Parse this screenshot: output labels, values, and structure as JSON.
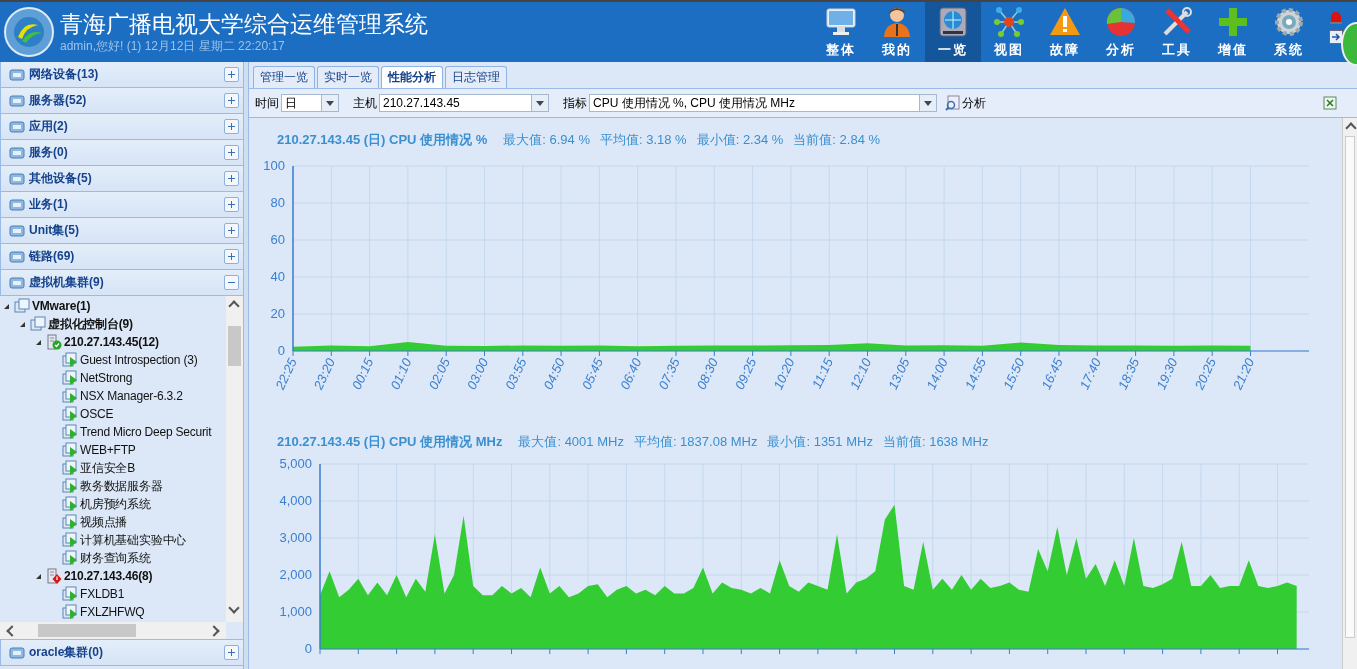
{
  "header": {
    "title": "青海广播电视大学综合运维管理系统",
    "subtitle": "admin,您好! (1) 12月12日 星期二 22:20:17"
  },
  "nav": [
    {
      "label": "整体",
      "selected": false
    },
    {
      "label": "我的",
      "selected": false
    },
    {
      "label": "一览",
      "selected": true
    },
    {
      "label": "视图",
      "selected": false
    },
    {
      "label": "故障",
      "selected": false
    },
    {
      "label": "分析",
      "selected": false
    },
    {
      "label": "工具",
      "selected": false
    },
    {
      "label": "增值",
      "selected": false
    },
    {
      "label": "系统",
      "selected": false
    }
  ],
  "sidebar": {
    "groups": [
      {
        "label": "网络设备(13)",
        "expanded": false
      },
      {
        "label": "服务器(52)",
        "expanded": false
      },
      {
        "label": "应用(2)",
        "expanded": false
      },
      {
        "label": "服务(0)",
        "expanded": false
      },
      {
        "label": "其他设备(5)",
        "expanded": false
      },
      {
        "label": "业务(1)",
        "expanded": false
      },
      {
        "label": "Unit集(5)",
        "expanded": false
      },
      {
        "label": "链路(69)",
        "expanded": false
      },
      {
        "label": "虚拟机集群(9)",
        "expanded": true,
        "children": [
          {
            "label": "VMware(1)",
            "kind": "cluster",
            "expanded": true,
            "children": [
              {
                "label": "虚拟化控制台(9)",
                "kind": "cluster",
                "expanded": true,
                "children": [
                  {
                    "label": "210.27.143.45(12)",
                    "kind": "host",
                    "alarm": false,
                    "expanded": true,
                    "children": [
                      {
                        "label": "Guest Introspection (3)",
                        "kind": "vm"
                      },
                      {
                        "label": "NetStrong",
                        "kind": "vm"
                      },
                      {
                        "label": "NSX Manager-6.3.2",
                        "kind": "vm"
                      },
                      {
                        "label": "OSCE",
                        "kind": "vm"
                      },
                      {
                        "label": "Trend Micro Deep Securit",
                        "kind": "vm"
                      },
                      {
                        "label": "WEB+FTP",
                        "kind": "vm"
                      },
                      {
                        "label": "亚信安全B",
                        "kind": "vm"
                      },
                      {
                        "label": "教务数据服务器",
                        "kind": "vm"
                      },
                      {
                        "label": "机房预约系统",
                        "kind": "vm"
                      },
                      {
                        "label": "视频点播",
                        "kind": "vm"
                      },
                      {
                        "label": "计算机基础实验中心",
                        "kind": "vm"
                      },
                      {
                        "label": "财务查询系统",
                        "kind": "vm"
                      }
                    ]
                  },
                  {
                    "label": "210.27.143.46(8)",
                    "kind": "host",
                    "alarm": true,
                    "expanded": true,
                    "children": [
                      {
                        "label": "FXLDB1",
                        "kind": "vm"
                      },
                      {
                        "label": "FXLZHFWQ",
                        "kind": "vm"
                      }
                    ]
                  }
                ]
              }
            ]
          }
        ]
      },
      {
        "label": "oracle集群(0)",
        "expanded": false
      }
    ]
  },
  "tabs": [
    {
      "label": "管理一览",
      "selected": false
    },
    {
      "label": "实时一览",
      "selected": false
    },
    {
      "label": "性能分析",
      "selected": true
    },
    {
      "label": "日志管理",
      "selected": false
    }
  ],
  "toolbar": {
    "time_label": "时间",
    "time_value": "日",
    "host_label": "主机",
    "host_value": "210.27.143.45",
    "metric_label": "指标",
    "metric_value": "CPU 使用情况 %, CPU 使用情况 MHz",
    "analyze_button": "分析"
  },
  "charts": [
    {
      "stats": [
        "最大值: 6.94 %",
        "平均值: 3.18 %",
        "最小值: 2.34 %",
        "当前值: 2.84 %"
      ],
      "chart_data": {
        "type": "area",
        "title": "210.27.143.45 (日) CPU 使用情况 %",
        "ylim": [
          0,
          100
        ],
        "yticks": [
          0,
          20,
          40,
          60,
          80,
          100
        ],
        "grid": true,
        "categories": [
          "22:25",
          "23:20",
          "00:15",
          "01:10",
          "02:05",
          "03:00",
          "03:55",
          "04:50",
          "05:45",
          "06:40",
          "07:35",
          "08:30",
          "09:25",
          "10:20",
          "11:15",
          "12:10",
          "13:05",
          "14:00",
          "14:55",
          "15:50",
          "16:45",
          "17:40",
          "18:35",
          "19:30",
          "20:25",
          "21:20"
        ],
        "series": [
          {
            "color": "#33cc33",
            "values": [
              2.3,
              2.9,
              2.6,
              4.9,
              2.8,
              2.7,
              3.0,
              2.8,
              2.9,
              2.6,
              2.8,
              3.0,
              2.9,
              3.1,
              3.3,
              4.2,
              2.9,
              3.1,
              2.8,
              4.6,
              3.3,
              2.9,
              3.0,
              2.8,
              3.0,
              2.8
            ]
          }
        ]
      }
    },
    {
      "stats": [
        "最大值: 4001 MHz",
        "平均值: 1837.08 MHz",
        "最小值: 1351 MHz",
        "当前值: 1638 MHz"
      ],
      "chart_data": {
        "type": "area",
        "title": "210.27.143.45 (日) CPU 使用情况 MHz",
        "ylim": [
          0,
          5000
        ],
        "yticks": [
          {
            "value": 0,
            "label": "0"
          },
          {
            "value": 1000,
            "label": "1,000"
          },
          {
            "value": 2000,
            "label": "2,000"
          },
          {
            "value": 3000,
            "label": "3,000"
          },
          {
            "value": 4000,
            "label": "4,000"
          },
          {
            "value": 5000,
            "label": "5,000"
          }
        ],
        "grid": true,
        "series": [
          {
            "color": "#33cc33",
            "values": [
              1450,
              2100,
              1400,
              1600,
              1900,
              1450,
              1800,
              1450,
              2000,
              1400,
              1900,
              1550,
              3100,
              1500,
              2000,
              3600,
              1700,
              1450,
              1450,
              1700,
              1500,
              1650,
              1400,
              2200,
              1500,
              1700,
              1400,
              1500,
              1700,
              1750,
              1400,
              1600,
              1700,
              1500,
              1600,
              1450,
              1700,
              1500,
              1500,
              1650,
              2200,
              1500,
              1800,
              1650,
              1600,
              1500,
              1650,
              1500,
              2400,
              1700,
              1550,
              1800,
              1700,
              1600,
              3100,
              1500,
              1800,
              1900,
              2100,
              3500,
              3900,
              1700,
              1600,
              2900,
              1600,
              1900,
              1600,
              2000,
              1600,
              1900,
              1650,
              1700,
              1800,
              1600,
              1550,
              2700,
              2100,
              3300,
              2000,
              3000,
              1900,
              2300,
              1700,
              2400,
              1700,
              3000,
              1700,
              1650,
              1750,
              1900,
              2900,
              1700,
              1700,
              2000,
              1650,
              1700,
              1700,
              2400,
              1700,
              1650,
              1700,
              1800,
              1700
            ]
          }
        ]
      }
    }
  ]
}
